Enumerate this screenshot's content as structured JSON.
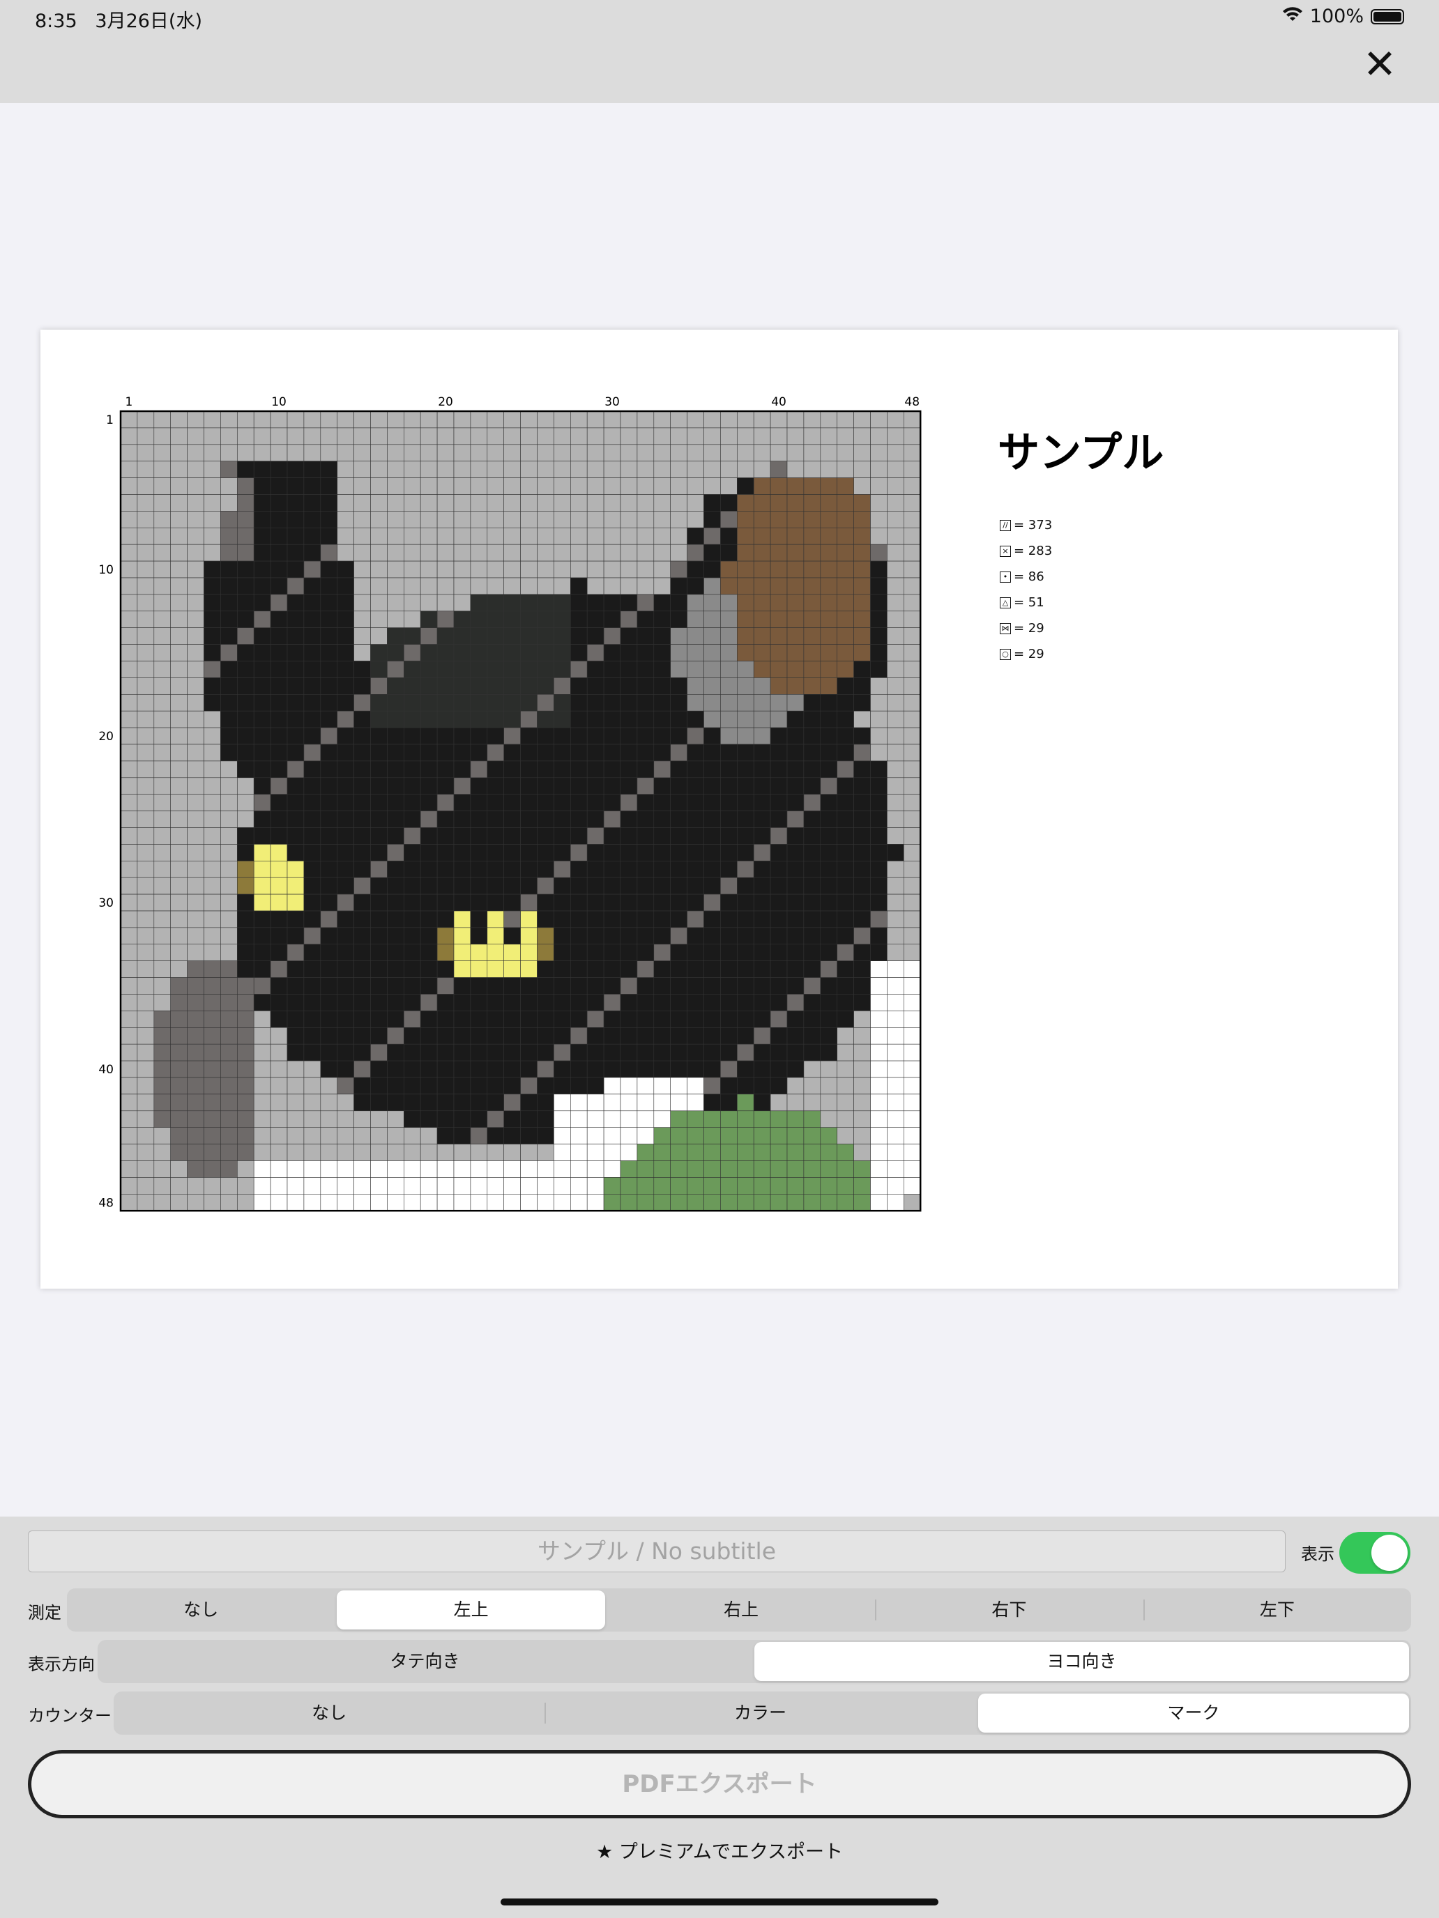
{
  "status": {
    "time": "8:35",
    "date": "3月26日(水)",
    "battery": "100%"
  },
  "paper": {
    "title": "サンプル",
    "cols": 48,
    "rows": 48,
    "col_ticks": [
      "1",
      "10",
      "20",
      "30",
      "40",
      "48"
    ],
    "row_ticks": [
      "1",
      "10",
      "20",
      "30",
      "40",
      "48"
    ],
    "legend": [
      {
        "symbol": "//",
        "count": "= 373"
      },
      {
        "symbol": "×",
        "count": "= 283"
      },
      {
        "symbol": "•",
        "count": "= 86"
      },
      {
        "symbol": "△",
        "count": "= 51"
      },
      {
        "symbol": "⋈",
        "count": "= 29"
      },
      {
        "symbol": "○",
        "count": "= 29"
      }
    ],
    "colors": {
      "background": "#b3b3b3",
      "black": "#1a1a1a",
      "dark": "#2b2d2b",
      "gray": "#6e6a69",
      "brown": "#7a5a3c",
      "yellow": "#f1ee77",
      "olive": "#8d7a3a",
      "white": "#ffffff",
      "green": "#6b9a5a",
      "midgray": "#8a8a8a"
    }
  },
  "panel": {
    "subtitle_placeholder": "サンプル / No subtitle",
    "show_label": "表示",
    "measure": {
      "label": "測定",
      "options": [
        "なし",
        "左上",
        "右上",
        "右下",
        "左下"
      ],
      "selected": 1
    },
    "orientation": {
      "label": "表示方向",
      "options": [
        "タテ向き",
        "ヨコ向き"
      ],
      "selected": 1
    },
    "counter": {
      "label": "カウンター",
      "options": [
        "なし",
        "カラー",
        "マーク"
      ],
      "selected": 2
    },
    "export_label": "PDFエクスポート",
    "premium_label": "★ プレミアムでエクスポート"
  }
}
